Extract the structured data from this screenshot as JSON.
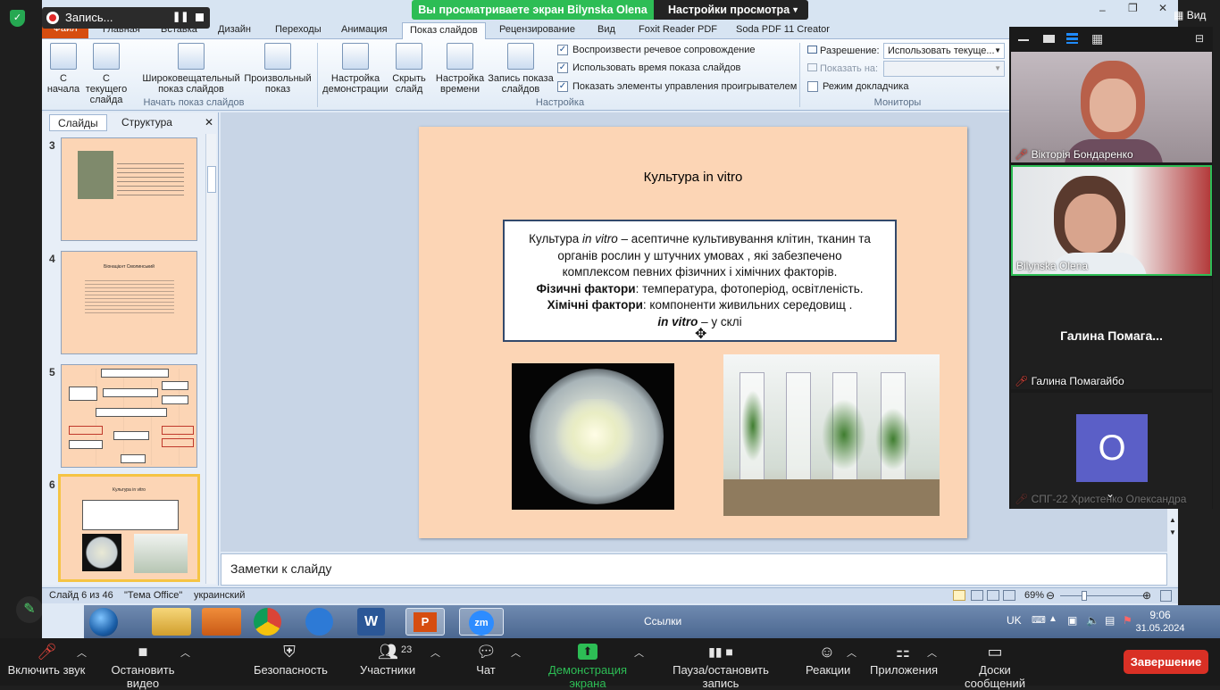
{
  "zoom_banner": {
    "viewing": "Вы просматриваете экран Bilynska Olena",
    "view_settings": "Настройки просмотра"
  },
  "recording": {
    "label": "Запись..."
  },
  "ppt": {
    "tabs": [
      "Файл",
      "Главная",
      "Вставка",
      "Дизайн",
      "Переходы",
      "Анимация",
      "Показ слайдов",
      "Рецензирование",
      "Вид",
      "Foxit Reader PDF",
      "Soda PDF 11 Creator"
    ],
    "active_tab": "Показ слайдов",
    "ribbon": {
      "from_start": "С начала",
      "from_current": "С текущего слайда",
      "widescreen": "Широковещательный показ слайдов",
      "custom": "Произвольный показ",
      "group_start": "Начать показ слайдов",
      "setup": "Настройка демонстрации",
      "hide": "Скрыть слайд",
      "rehearse": "Настройка времени",
      "record": "Запись показа слайдов",
      "chk_narration": "Воспроизвести речевое сопровождение",
      "chk_timings": "Использовать время показа слайдов",
      "chk_controls": "Показать элементы управления проигрывателем",
      "group_setup": "Настройка",
      "resolution_label": "Разрешение:",
      "resolution_value": "Использовать текуще...",
      "show_on_label": "Показать на:",
      "presenter": "Режим докладчика",
      "group_monitors": "Мониторы"
    },
    "pane": {
      "tab_slides": "Слайды",
      "tab_outline": "Структура",
      "thumbs": [
        "3",
        "4",
        "5",
        "6"
      ]
    },
    "slide": {
      "title": "Культура in vitro",
      "line1a": "Культура ",
      "line1b": "in vitro",
      "line1c": " – асептичне культивування клітин, тканин та",
      "line2": "органів  рослин у  штучних умовах , які забезпечено",
      "line3": "комплексом  певних фізичних і хімічних факторів.",
      "line4a": "Фізичні фактори",
      "line4b": ": температура, фотоперіод, освітленість.",
      "line5a": "Хімічні фактори",
      "line5b": ":  компоненти живильних середовищ .",
      "line6a": "in vitro",
      "line6b": " –  у склі"
    },
    "thumb6_title": "Культура in vitro",
    "thumb4_title": "Біонацієнт  Смолинський",
    "notes": "Заметки к слайду",
    "status": {
      "slide": "Слайд 6 из 46",
      "theme": "\"Тема Office\"",
      "lang": "украинский",
      "zoom": "69%"
    },
    "taskbar": {
      "links": "Ссылки",
      "lang": "UK",
      "time": "9:06",
      "date": "31.05.2024"
    }
  },
  "participants": [
    {
      "name": "Вікторія Бондаренко"
    },
    {
      "name": "Bilynska Olena"
    },
    {
      "name": "Галина  Помага..."
    },
    {
      "name": "Галина Помагайбо"
    },
    {
      "initial": "О",
      "name": "СПГ-22 Христенко Олександра"
    }
  ],
  "panel_view": "Вид",
  "zoombar": {
    "mute": "Включить звук",
    "video": "Остановить видео",
    "security": "Безопасность",
    "participants": "Участники",
    "participants_count": "23",
    "chat": "Чат",
    "share": "Демонстрация экрана",
    "pause": "Пауза/остановить запись",
    "reactions": "Реакции",
    "apps": "Приложения",
    "whiteboards": "Доски сообщений",
    "end": "Завершение"
  },
  "colors": {
    "slide_bg": "#fcd5b5",
    "share_green": "#2dbd55",
    "end_red": "#d93025",
    "ppt_file": "#d64d10"
  }
}
